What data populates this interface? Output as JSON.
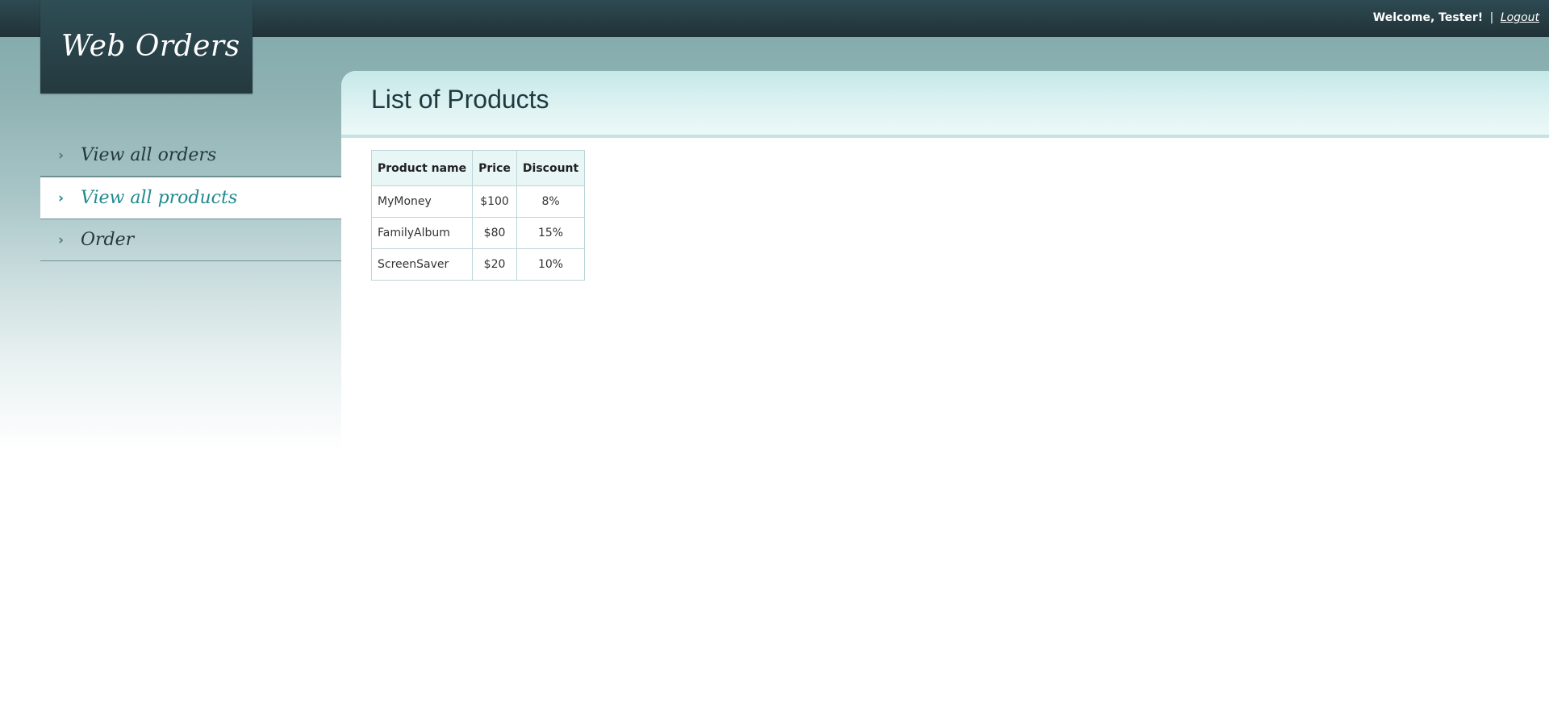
{
  "header": {
    "welcome_text": "Welcome, Tester!",
    "separator": "|",
    "logout_label": "Logout"
  },
  "logo": {
    "title": "Web Orders"
  },
  "sidebar": {
    "items": [
      {
        "label": "View all orders",
        "active": false,
        "icon": "chevron-right-icon"
      },
      {
        "label": "View all products",
        "active": true,
        "icon": "chevron-right-icon"
      },
      {
        "label": "Order",
        "active": false,
        "icon": "chevron-right-icon"
      }
    ]
  },
  "main": {
    "title": "List of Products",
    "table": {
      "columns": [
        "Product name",
        "Price",
        "Discount"
      ],
      "rows": [
        [
          "MyMoney",
          "$100",
          "8%"
        ],
        [
          "FamilyAlbum",
          "$80",
          "15%"
        ],
        [
          "ScreenSaver",
          "$20",
          "10%"
        ]
      ]
    }
  },
  "colors": {
    "topbar": "#203237",
    "accent": "#1f8a8f",
    "header_band": "#c6e8e8"
  }
}
